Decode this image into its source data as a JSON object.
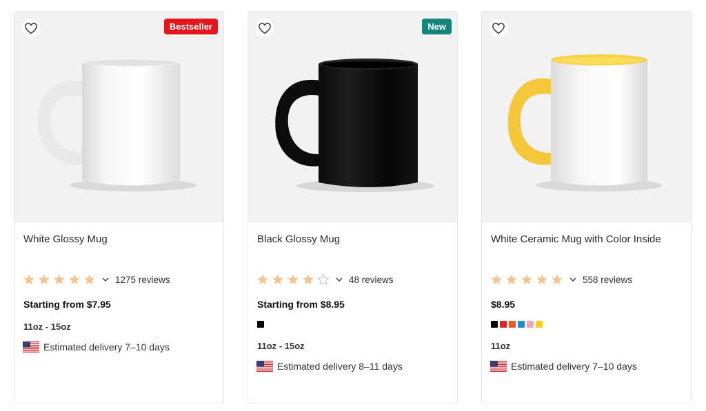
{
  "products": [
    {
      "name": "White Glossy Mug",
      "badge": "Bestseller",
      "badge_color": "#e8141b",
      "rating": 5,
      "reviews": "1275 reviews",
      "price": "Starting from $7.95",
      "colors": [],
      "size": "11oz - 15oz",
      "delivery": "Estimated delivery 7–10 days"
    },
    {
      "name": "Black Glossy Mug",
      "badge": "New",
      "badge_color": "#15847a",
      "rating": 4,
      "reviews": "48 reviews",
      "price": "Starting from $8.95",
      "colors": [
        "#000000"
      ],
      "size": "11oz - 15oz",
      "delivery": "Estimated delivery 8–11 days"
    },
    {
      "name": "White Ceramic Mug with Color Inside",
      "badge": "",
      "badge_color": "",
      "rating": 5,
      "reviews": "558 reviews",
      "price": "$8.95",
      "colors": [
        "#000000",
        "#e3232c",
        "#f05a22",
        "#1a8fcf",
        "#f4a3b4",
        "#f8cf1d"
      ],
      "size": "11oz",
      "delivery": "Estimated delivery 7–10 days"
    }
  ],
  "icons": {
    "favorite": "heart-outline-icon",
    "rating_expand": "chevron-down-icon",
    "origin_flag": "us-flag-icon"
  },
  "colors": {
    "star_filled": "#f5c491",
    "star_empty": "#c9c9c9",
    "image_background": "#f2f2f2"
  }
}
